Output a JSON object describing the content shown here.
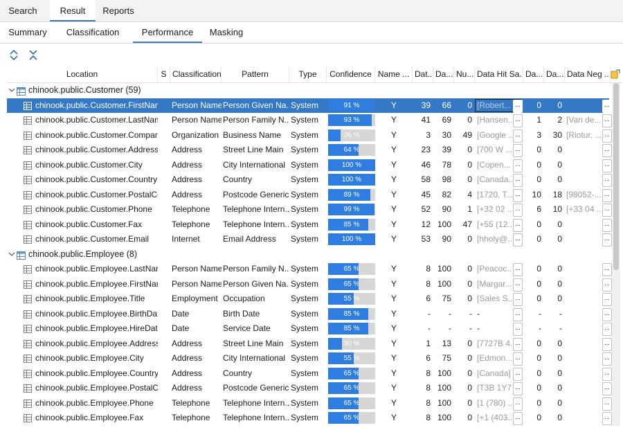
{
  "tabs_top": [
    {
      "label": "Search",
      "active": false
    },
    {
      "label": "Result",
      "active": true
    },
    {
      "label": "Reports",
      "active": false
    }
  ],
  "tabs_sub": [
    {
      "label": "Summary",
      "active": false
    },
    {
      "label": "Classification",
      "active": false
    },
    {
      "label": "Performance",
      "active": true
    },
    {
      "label": "Masking",
      "active": false
    }
  ],
  "toolbar": {
    "expand_icon": "expand-all-icon",
    "collapse_icon": "collapse-all-icon"
  },
  "columns": [
    "Location",
    "S",
    "Classification",
    "Pattern",
    "Type",
    "Confidence",
    "Name ...",
    "Dat...",
    "Da...",
    "Nu...",
    "Data Hit Sa...",
    "Da...",
    "Da...",
    "Data Neg ..."
  ],
  "colors": {
    "accent": "#3478c6",
    "bar": "#2f7de1",
    "bar_bg": "#d6d6d6"
  },
  "groups": [
    {
      "label": "chinook.public.Customer (59)",
      "rows": [
        {
          "location": "chinook.public.Customer.FirstNam",
          "classification": "Person Name",
          "pattern": "Person Given Na...",
          "type": "System",
          "confidence": 91,
          "conf_label": "91 %",
          "name": "Y",
          "c1": "39",
          "c2": "66",
          "c3": "0",
          "hit": "[Robert...",
          "c4": "0",
          "c5": "0",
          "neg": "",
          "selected": true
        },
        {
          "location": "chinook.public.Customer.LastNam",
          "classification": "Person Name",
          "pattern": "Person Family N...",
          "type": "System",
          "confidence": 93,
          "conf_label": "93 %",
          "name": "Y",
          "c1": "41",
          "c2": "69",
          "c3": "0",
          "hit": "[Hansen...",
          "c4": "1",
          "c5": "2",
          "neg": "[Van de..."
        },
        {
          "location": "chinook.public.Customer.Compan",
          "classification": "Organization",
          "pattern": "Business Name",
          "type": "System",
          "confidence": 26,
          "conf_label": "26 %",
          "name": "Y",
          "c1": "3",
          "c2": "30",
          "c3": "49",
          "hit": "[Google ...",
          "c4": "3",
          "c5": "30",
          "neg": "[Riotur, ..."
        },
        {
          "location": "chinook.public.Customer.Address",
          "classification": "Address",
          "pattern": "Street Line Main",
          "type": "System",
          "confidence": 64,
          "conf_label": "64 %",
          "name": "Y",
          "c1": "23",
          "c2": "39",
          "c3": "0",
          "hit": "[700 W ...",
          "c4": "0",
          "c5": "0",
          "neg": ""
        },
        {
          "location": "chinook.public.Customer.City",
          "classification": "Address",
          "pattern": "City International",
          "type": "System",
          "confidence": 100,
          "conf_label": "100 %",
          "name": "Y",
          "c1": "46",
          "c2": "78",
          "c3": "0",
          "hit": "[Copen...",
          "c4": "0",
          "c5": "0",
          "neg": ""
        },
        {
          "location": "chinook.public.Customer.Country",
          "classification": "Address",
          "pattern": "Country",
          "type": "System",
          "confidence": 100,
          "conf_label": "100 %",
          "name": "Y",
          "c1": "58",
          "c2": "98",
          "c3": "0",
          "hit": "[Canada...",
          "c4": "0",
          "c5": "0",
          "neg": ""
        },
        {
          "location": "chinook.public.Customer.PostalCc",
          "classification": "Address",
          "pattern": "Postcode Generic",
          "type": "System",
          "confidence": 89,
          "conf_label": "89 %",
          "name": "Y",
          "c1": "45",
          "c2": "82",
          "c3": "4",
          "hit": "[1720, T...",
          "c4": "10",
          "c5": "18",
          "neg": "[98052-..."
        },
        {
          "location": "chinook.public.Customer.Phone",
          "classification": "Telephone",
          "pattern": "Telephone Intern...",
          "type": "System",
          "confidence": 99,
          "conf_label": "99 %",
          "name": "Y",
          "c1": "52",
          "c2": "90",
          "c3": "1",
          "hit": "[+32 02 ...",
          "c4": "6",
          "c5": "10",
          "neg": "[+33 04 ..."
        },
        {
          "location": "chinook.public.Customer.Fax",
          "classification": "Telephone",
          "pattern": "Telephone Intern...",
          "type": "System",
          "confidence": 85,
          "conf_label": "85 %",
          "name": "Y",
          "c1": "12",
          "c2": "100",
          "c3": "47",
          "hit": "[+55 (12...",
          "c4": "0",
          "c5": "0",
          "neg": ""
        },
        {
          "location": "chinook.public.Customer.Email",
          "classification": "Internet",
          "pattern": "Email Address",
          "type": "System",
          "confidence": 100,
          "conf_label": "100 %",
          "name": "Y",
          "c1": "53",
          "c2": "90",
          "c3": "0",
          "hit": "[hholy@...",
          "c4": "0",
          "c5": "0",
          "neg": ""
        }
      ]
    },
    {
      "label": "chinook.public.Employee (8)",
      "rows": [
        {
          "location": "chinook.public.Employee.LastNam",
          "classification": "Person Name",
          "pattern": "Person Family N...",
          "type": "System",
          "confidence": 65,
          "conf_label": "65 %",
          "name": "Y",
          "c1": "8",
          "c2": "100",
          "c3": "0",
          "hit": "[Peacoc...",
          "c4": "0",
          "c5": "0",
          "neg": ""
        },
        {
          "location": "chinook.public.Employee.FirstNam",
          "classification": "Person Name",
          "pattern": "Person Given Na...",
          "type": "System",
          "confidence": 65,
          "conf_label": "65 %",
          "name": "Y",
          "c1": "8",
          "c2": "100",
          "c3": "0",
          "hit": "[Margar...",
          "c4": "0",
          "c5": "0",
          "neg": ""
        },
        {
          "location": "chinook.public.Employee.Title",
          "classification": "Employment",
          "pattern": "Occupation",
          "type": "System",
          "confidence": 55,
          "conf_label": "55 %",
          "name": "Y",
          "c1": "6",
          "c2": "75",
          "c3": "0",
          "hit": "[Sales S...",
          "c4": "0",
          "c5": "0",
          "neg": ""
        },
        {
          "location": "chinook.public.Employee.BirthDat",
          "classification": "Date",
          "pattern": "Birth Date",
          "type": "System",
          "confidence": 85,
          "conf_label": "85 %",
          "name": "Y",
          "c1": "-",
          "c2": "-",
          "c3": "-",
          "hit": "-",
          "c4": "-",
          "c5": "-",
          "neg": ""
        },
        {
          "location": "chinook.public.Employee.HireDate",
          "classification": "Date",
          "pattern": "Service Date",
          "type": "System",
          "confidence": 85,
          "conf_label": "85 %",
          "name": "Y",
          "c1": "-",
          "c2": "-",
          "c3": "-",
          "hit": "-",
          "c4": "-",
          "c5": "-",
          "neg": ""
        },
        {
          "location": "chinook.public.Employee.Address",
          "classification": "Address",
          "pattern": "Street Line Main",
          "type": "System",
          "confidence": 30,
          "conf_label": "30 %",
          "name": "Y",
          "c1": "1",
          "c2": "13",
          "c3": "0",
          "hit": "[7727B 4...",
          "c4": "0",
          "c5": "0",
          "neg": ""
        },
        {
          "location": "chinook.public.Employee.City",
          "classification": "Address",
          "pattern": "City International",
          "type": "System",
          "confidence": 55,
          "conf_label": "55 %",
          "name": "Y",
          "c1": "6",
          "c2": "75",
          "c3": "0",
          "hit": "[Edmon...",
          "c4": "0",
          "c5": "0",
          "neg": ""
        },
        {
          "location": "chinook.public.Employee.Country",
          "classification": "Address",
          "pattern": "Country",
          "type": "System",
          "confidence": 65,
          "conf_label": "65 %",
          "name": "Y",
          "c1": "8",
          "c2": "100",
          "c3": "0",
          "hit": "[Canada]",
          "c4": "0",
          "c5": "0",
          "neg": ""
        },
        {
          "location": "chinook.public.Employee.PostalCc",
          "classification": "Address",
          "pattern": "Postcode Generic",
          "type": "System",
          "confidence": 65,
          "conf_label": "65 %",
          "name": "Y",
          "c1": "8",
          "c2": "100",
          "c3": "0",
          "hit": "[T3B 1Y7...",
          "c4": "0",
          "c5": "0",
          "neg": ""
        },
        {
          "location": "chinook.public.Employee.Phone",
          "classification": "Telephone",
          "pattern": "Telephone Intern...",
          "type": "System",
          "confidence": 65,
          "conf_label": "65 %",
          "name": "Y",
          "c1": "8",
          "c2": "100",
          "c3": "0",
          "hit": "[1 (780) ...",
          "c4": "0",
          "c5": "0",
          "neg": ""
        },
        {
          "location": "chinook.public.Employee.Fax",
          "classification": "Telephone",
          "pattern": "Telephone Intern...",
          "type": "System",
          "confidence": 65,
          "conf_label": "65 %",
          "name": "Y",
          "c1": "8",
          "c2": "100",
          "c3": "0",
          "hit": "[+1 (403...",
          "c4": "0",
          "c5": "0",
          "neg": ""
        }
      ]
    }
  ]
}
